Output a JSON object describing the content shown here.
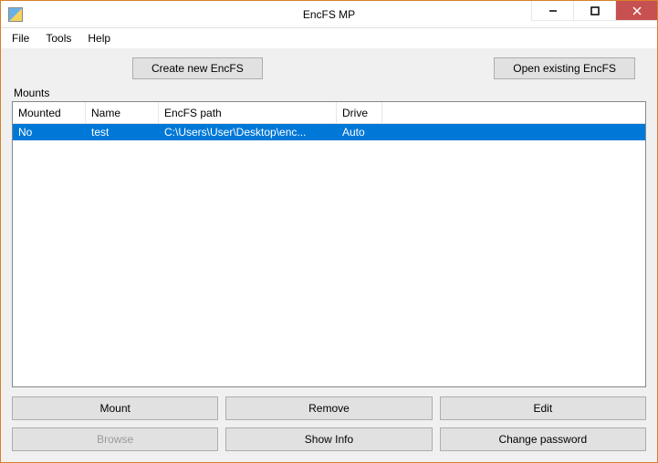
{
  "window": {
    "title": "EncFS MP"
  },
  "menu": {
    "file": "File",
    "tools": "Tools",
    "help": "Help"
  },
  "topButtons": {
    "createNew": "Create new EncFS",
    "openExisting": "Open existing EncFS"
  },
  "mounts": {
    "label": "Mounts",
    "columns": {
      "mounted": "Mounted",
      "name": "Name",
      "path": "EncFS path",
      "drive": "Drive"
    },
    "rows": [
      {
        "mounted": "No",
        "name": "test",
        "path": "C:\\Users\\User\\Desktop\\enc...",
        "drive": "Auto"
      }
    ]
  },
  "bottomButtons": {
    "mount": "Mount",
    "remove": "Remove",
    "edit": "Edit",
    "browse": "Browse",
    "showInfo": "Show Info",
    "changePassword": "Change password"
  }
}
